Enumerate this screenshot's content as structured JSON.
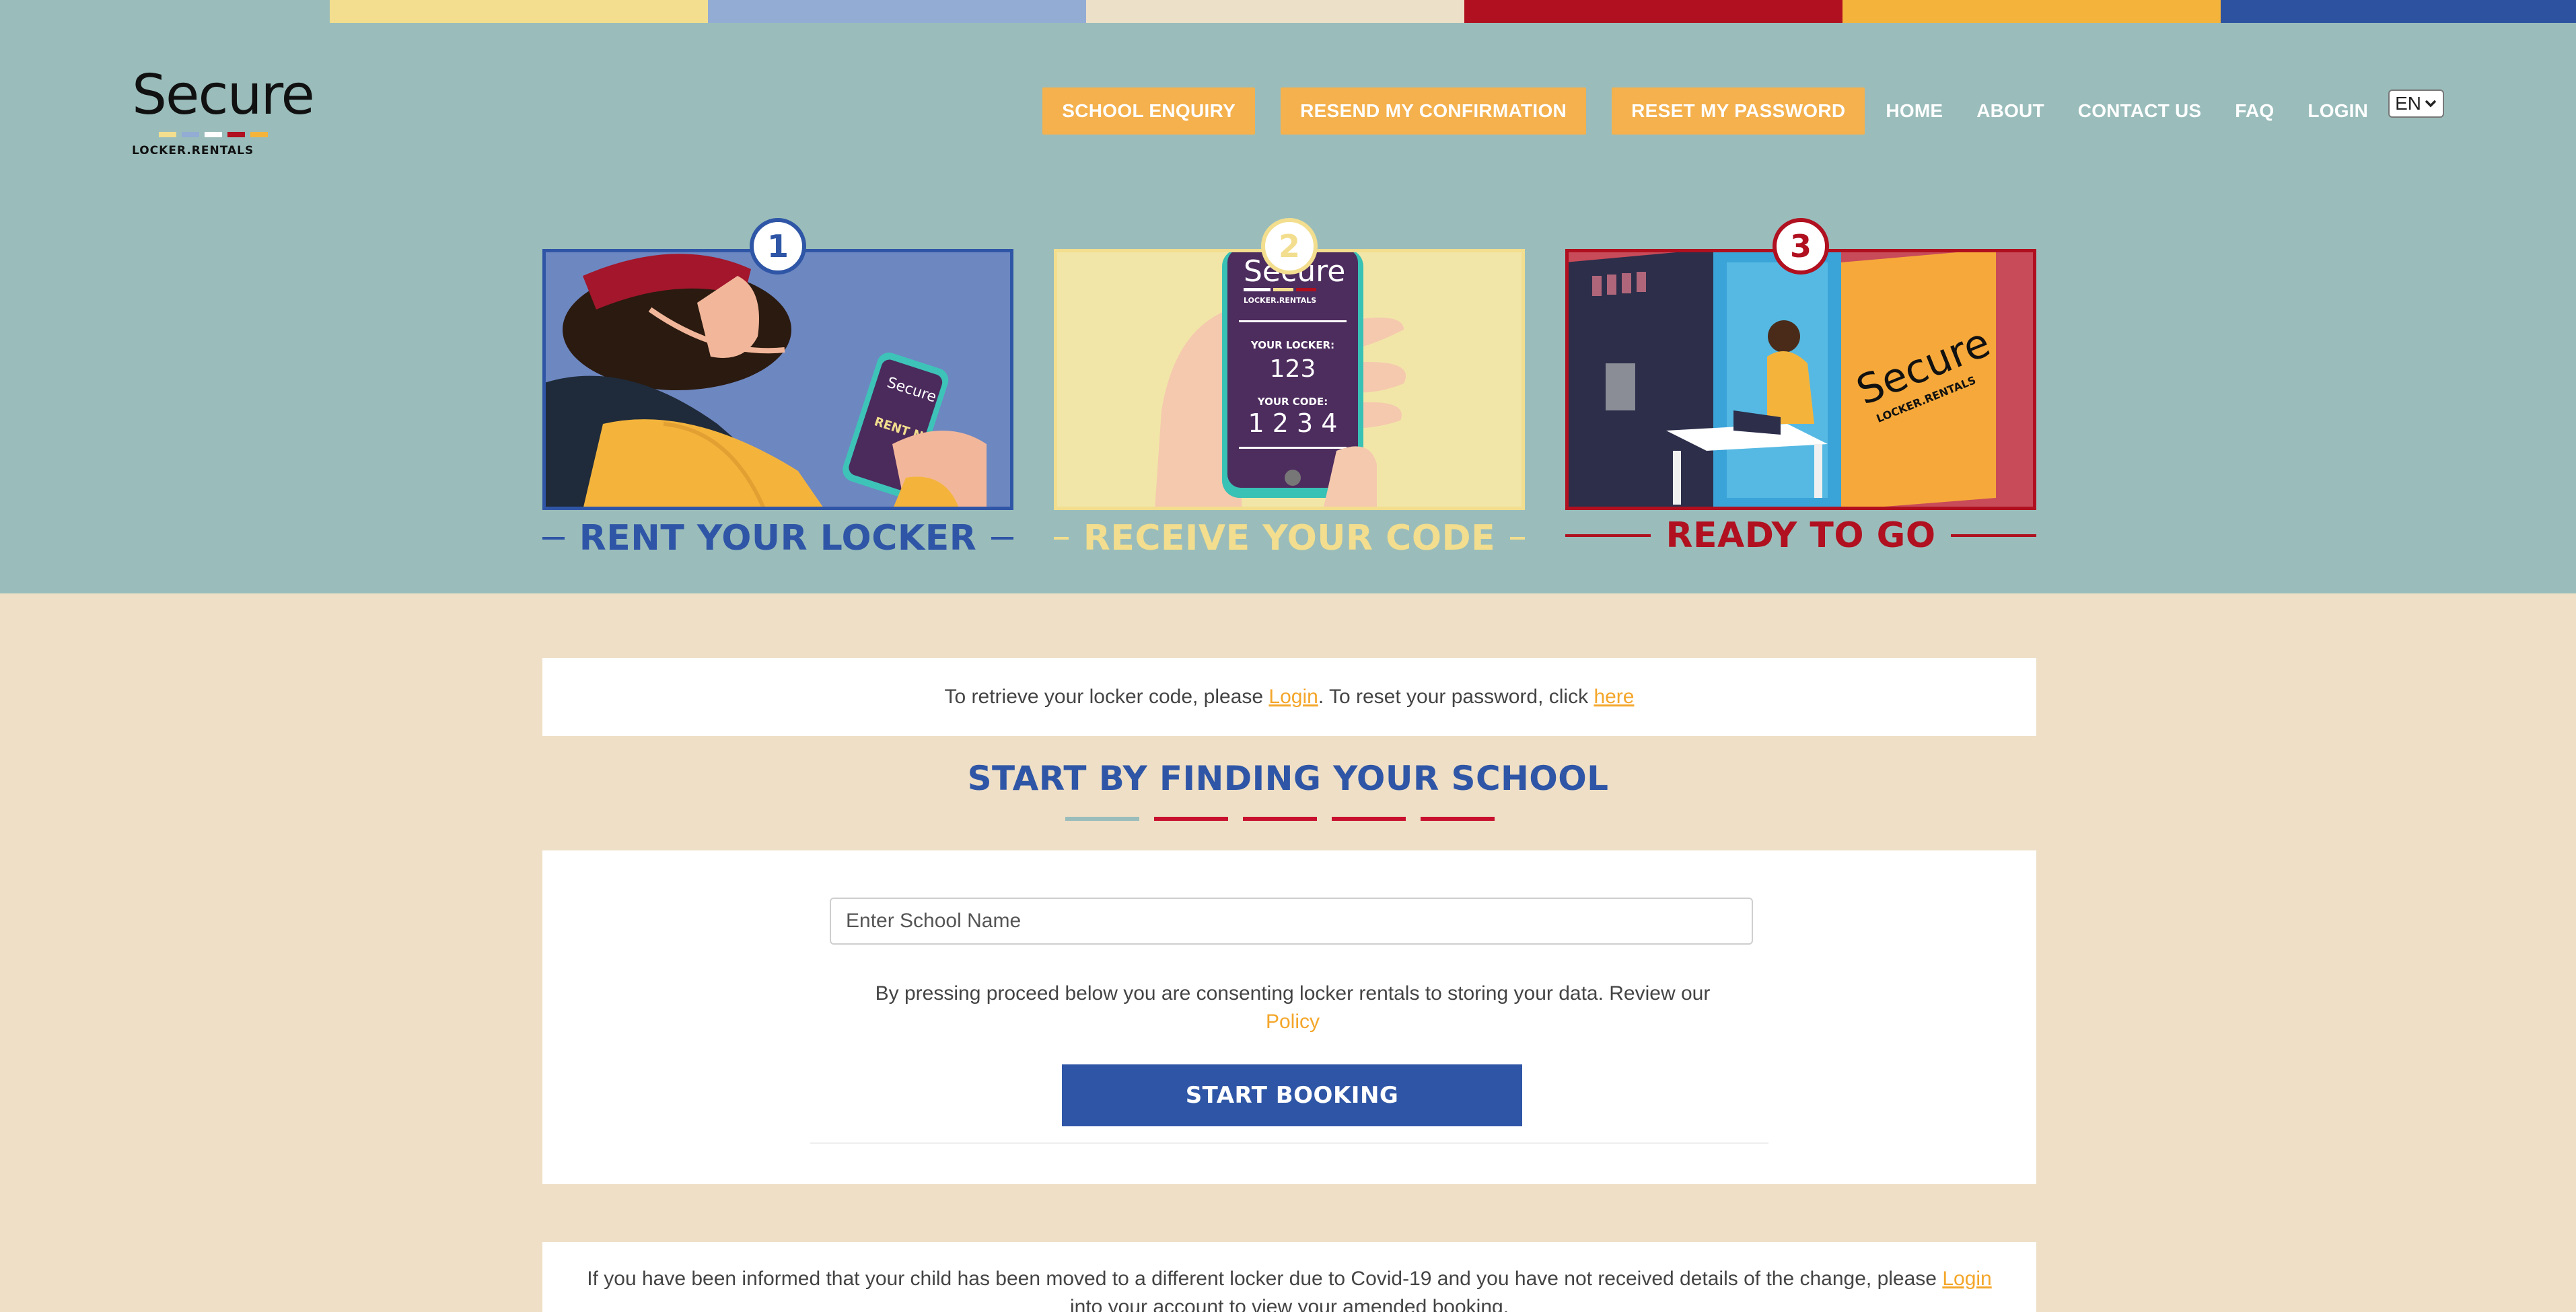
{
  "brand": {
    "logo_word": "Secure",
    "logo_sub": "LOCKER.RENTALS",
    "strip_colors": [
      "#9abdbb",
      "#f2de8e",
      "#92acd4",
      "#ede0c8",
      "#b0101f",
      "#f4b43c",
      "#2c52a0"
    ],
    "logo_bar_colors": [
      "#f2de8e",
      "#92acd4",
      "#ffffff",
      "#b0101f",
      "#f4b43c"
    ]
  },
  "nav": {
    "pills": [
      "SCHOOL ENQUIRY",
      "RESEND MY CONFIRMATION",
      "RESET MY PASSWORD"
    ],
    "links": [
      "HOME",
      "ABOUT",
      "CONTACT US",
      "FAQ",
      "LOGIN"
    ],
    "language": "EN"
  },
  "steps": [
    {
      "number": "1",
      "title": "RENT YOUR LOCKER",
      "color": "#2f56a6",
      "phone_brand": "Secure",
      "phone_text": "RENT NOW"
    },
    {
      "number": "2",
      "title": "RECEIVE YOUR CODE",
      "color": "#f2de8e",
      "phone_brand": "Secure",
      "phone_sub": "LOCKER.RENTALS",
      "locker_label": "YOUR LOCKER:",
      "locker_number": "123",
      "code_label": "YOUR CODE:",
      "code_value": "1 2 3 4"
    },
    {
      "number": "3",
      "title": "READY TO GO",
      "color": "#b0101f",
      "door_brand": "Secure",
      "door_sub": "LOCKER.RENTALS"
    }
  ],
  "notice": {
    "prefix": "To retrieve your locker code, please ",
    "login_link": "Login",
    "middle": ". To reset your password, click ",
    "here_link": "here"
  },
  "finder": {
    "heading": "START BY FINDING YOUR SCHOOL",
    "dash_colors": [
      "#9abdbb",
      "#c8102e",
      "#c8102e",
      "#c8102e",
      "#c8102e"
    ],
    "placeholder": "Enter School Name",
    "consent_text": "By pressing proceed below you are consenting locker rentals to storing your data. Review our ",
    "policy_link": "Policy",
    "button": "START BOOKING"
  },
  "covid": {
    "text_before": "If you have been informed that your child has been moved to a different locker due to Covid-19 and you have not received details of the change, please ",
    "login_link": "Login",
    "text_after": " into your account to view your amended booking."
  }
}
